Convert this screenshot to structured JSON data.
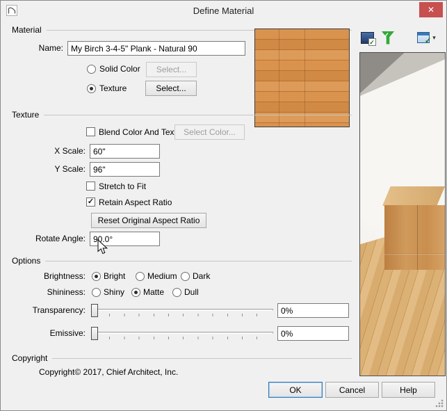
{
  "colors": {
    "dialog_bg": "#f0f0f0",
    "close_button_red": "#c75050",
    "default_button_focus": "#3079b8",
    "texture_wood": "#d28c47",
    "preview_floor_wood": "#d8ac6e"
  },
  "icons": {
    "close": "✕",
    "check": "✓",
    "dropdown_arrow": "▾"
  },
  "titlebar": {
    "title": "Define Material"
  },
  "material": {
    "section_label": "Material",
    "name_label": "Name:",
    "name_value": "My Birch 3-4-5\" Plank - Natural 90",
    "solid_color_label": "Solid Color",
    "solid_color_select_label": "Select...",
    "texture_label": "Texture",
    "texture_select_label": "Select..."
  },
  "texture": {
    "section_label": "Texture",
    "blend_label": "Blend Color And Texture",
    "select_color_label": "Select Color...",
    "x_scale_label": "X Scale:",
    "x_scale_value": "60\"",
    "y_scale_label": "Y Scale:",
    "y_scale_value": "96\"",
    "stretch_label": "Stretch to Fit",
    "retain_label": "Retain Aspect Ratio",
    "retain_checked": true,
    "reset_button_label": "Reset Original Aspect Ratio",
    "rotate_label": "Rotate Angle:",
    "rotate_value": "90.0°"
  },
  "options": {
    "section_label": "Options",
    "brightness_label": "Brightness:",
    "brightness": [
      {
        "label": "Bright",
        "selected": true
      },
      {
        "label": "Medium",
        "selected": false
      },
      {
        "label": "Dark",
        "selected": false
      }
    ],
    "shininess_label": "Shininess:",
    "shininess": [
      {
        "label": "Shiny",
        "selected": false
      },
      {
        "label": "Matte",
        "selected": true
      },
      {
        "label": "Dull",
        "selected": false
      }
    ],
    "transparency_label": "Transparency:",
    "transparency_value": "0%",
    "emissive_label": "Emissive:",
    "emissive_value": "0%"
  },
  "copyright": {
    "section_label": "Copyright",
    "text": "Copyright© 2017, Chief Architect, Inc."
  },
  "footer": {
    "ok_label": "OK",
    "cancel_label": "Cancel",
    "help_label": "Help"
  },
  "preview": {
    "toolbar_icons": [
      "display-toggle-icon",
      "apply-filter-icon",
      "view-options-icon"
    ]
  }
}
